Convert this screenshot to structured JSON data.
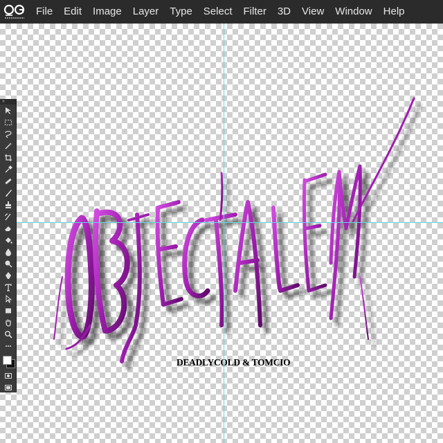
{
  "app": {
    "logo_icon": "app-logo-icon"
  },
  "menu": {
    "items": [
      {
        "label": "File"
      },
      {
        "label": "Edit"
      },
      {
        "label": "Image"
      },
      {
        "label": "Layer"
      },
      {
        "label": "Type"
      },
      {
        "label": "Select"
      },
      {
        "label": "Filter"
      },
      {
        "label": "3D"
      },
      {
        "label": "View"
      },
      {
        "label": "Window"
      },
      {
        "label": "Help"
      }
    ]
  },
  "toolbar": {
    "grip_label": "»",
    "tools": [
      {
        "name": "move-tool-icon"
      },
      {
        "name": "marquee-tool-icon"
      },
      {
        "name": "lasso-tool-icon"
      },
      {
        "name": "magic-wand-tool-icon"
      },
      {
        "name": "crop-tool-icon"
      },
      {
        "name": "eyedropper-tool-icon"
      },
      {
        "name": "healing-brush-tool-icon"
      },
      {
        "name": "brush-tool-icon"
      },
      {
        "name": "clone-stamp-tool-icon"
      },
      {
        "name": "history-brush-tool-icon"
      },
      {
        "name": "eraser-tool-icon"
      },
      {
        "name": "paint-bucket-tool-icon"
      },
      {
        "name": "blur-tool-icon"
      },
      {
        "name": "dodge-tool-icon"
      },
      {
        "name": "pen-tool-icon"
      },
      {
        "name": "type-tool-icon"
      },
      {
        "name": "path-selection-tool-icon"
      },
      {
        "name": "rectangle-tool-icon"
      },
      {
        "name": "hand-tool-icon"
      },
      {
        "name": "zoom-tool-icon"
      },
      {
        "name": "more-tools-icon"
      }
    ],
    "foreground_color": "#ffffff",
    "background_color": "#111111"
  },
  "canvas": {
    "guide_color": "#5fd8e0",
    "artwork": {
      "wordmark": "OBJECTAL EM",
      "wordmark_color": "#a020b0",
      "credit": "DEADLYCOLD & TOMCIO"
    }
  }
}
